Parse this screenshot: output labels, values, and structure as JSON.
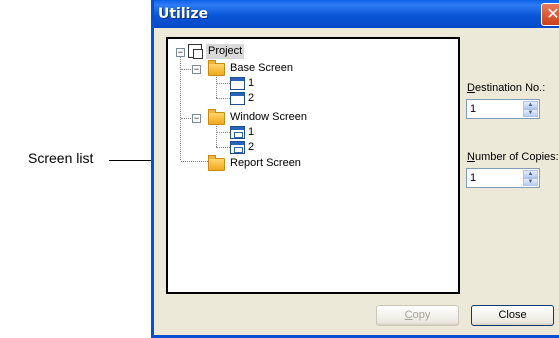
{
  "callout": {
    "label": "Screen list"
  },
  "dialog": {
    "title": "Utilize",
    "close_glyph": "✕",
    "tree": {
      "root": {
        "label": "Project",
        "icon": "project-icon",
        "expander": "−"
      },
      "groups": [
        {
          "label": "Base Screen",
          "icon": "folder-icon",
          "expander": "−",
          "children": [
            {
              "label": "1",
              "icon": "base-screen-icon"
            },
            {
              "label": "2",
              "icon": "base-screen-icon"
            }
          ]
        },
        {
          "label": "Window Screen",
          "icon": "folder-icon",
          "expander": "−",
          "children": [
            {
              "label": "1",
              "icon": "window-screen-icon"
            },
            {
              "label": "2",
              "icon": "window-screen-icon"
            }
          ]
        },
        {
          "label": "Report Screen",
          "icon": "folder-icon",
          "children": []
        }
      ]
    },
    "destination": {
      "label_underlined": "D",
      "label_rest": "estination No.:",
      "value": "1"
    },
    "copies": {
      "label_underlined": "N",
      "label_rest": "umber of Copies:",
      "value": "1"
    },
    "buttons": {
      "copy_underlined": "C",
      "copy_rest": "opy",
      "close": "Close"
    }
  }
}
